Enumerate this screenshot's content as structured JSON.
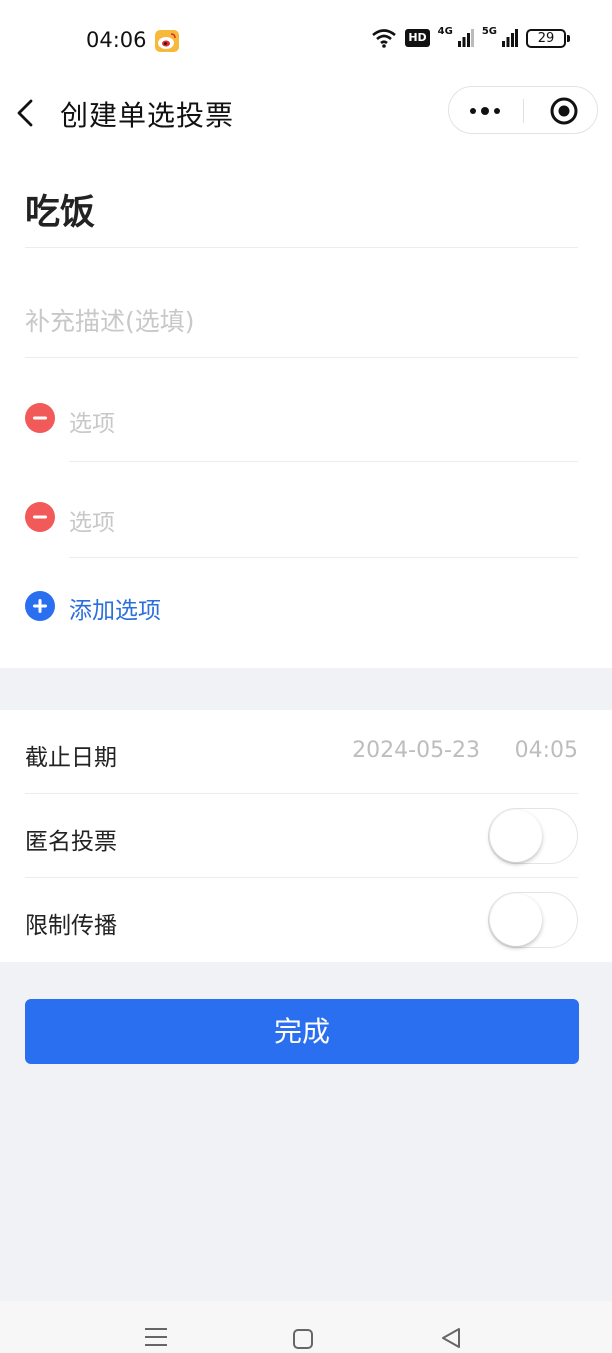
{
  "status_bar": {
    "time": "04:06",
    "hd_label": "HD",
    "net_4g": "4G",
    "net_5g": "5G",
    "battery": "29"
  },
  "nav": {
    "title": "创建单选投票"
  },
  "form": {
    "title_value": "吃饭",
    "description_placeholder": "补充描述(选填)",
    "options": [
      {
        "placeholder": "选项"
      },
      {
        "placeholder": "选项"
      }
    ],
    "add_option_label": "添加选项"
  },
  "settings": {
    "deadline_label": "截止日期",
    "deadline_date": "2024-05-23",
    "deadline_time": "04:05",
    "anonymous_label": "匿名投票",
    "anonymous_on": false,
    "restrict_label": "限制传播",
    "restrict_on": false
  },
  "done_label": "完成",
  "colors": {
    "accent": "#2a6ff0",
    "danger": "#f25a5a",
    "link": "#2a6fdb"
  }
}
